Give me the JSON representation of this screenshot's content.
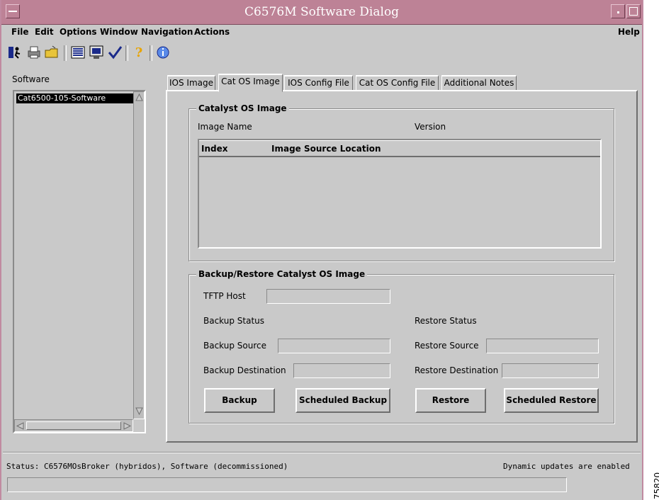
{
  "window": {
    "title": "C6576M Software Dialog"
  },
  "menubar": {
    "items": [
      {
        "name": "menu-file",
        "label": "File"
      },
      {
        "name": "menu-edit",
        "label": "Edit"
      },
      {
        "name": "menu-options",
        "label": "Options"
      },
      {
        "name": "menu-window",
        "label": "Window"
      },
      {
        "name": "menu-navigation",
        "label": "Navigation"
      },
      {
        "name": "menu-actions",
        "label": "Actions"
      }
    ],
    "help": "Help"
  },
  "toolbar": {
    "icons": [
      "exit-icon",
      "print-icon",
      "open-folder-icon",
      "list-icon",
      "monitor-icon",
      "check-icon",
      "help-icon",
      "info-icon"
    ]
  },
  "sidebar": {
    "label": "Software",
    "items": [
      "Cat6500-105-Software"
    ]
  },
  "tabs": [
    {
      "label": "IOS Image",
      "active": false
    },
    {
      "label": "Cat OS Image",
      "active": true
    },
    {
      "label": "IOS Config File",
      "active": false
    },
    {
      "label": "Cat OS Config File",
      "active": false
    },
    {
      "label": "Additional Notes",
      "active": false
    }
  ],
  "catos_group": {
    "title": "Catalyst OS Image",
    "image_name_label": "Image Name",
    "version_label": "Version",
    "table_headers": [
      "Index",
      "Image Source Location"
    ]
  },
  "backup_group": {
    "title": "Backup/Restore Catalyst OS Image",
    "tftp_host_label": "TFTP Host",
    "backup_status_label": "Backup Status",
    "restore_status_label": "Restore Status",
    "backup_source_label": "Backup Source",
    "restore_source_label": "Restore Source",
    "backup_destination_label": "Backup Destination",
    "restore_destination_label": "Restore Destination",
    "buttons": {
      "backup": "Backup",
      "scheduled_backup": "Scheduled Backup",
      "restore": "Restore",
      "scheduled_restore": "Scheduled Restore"
    }
  },
  "statusbar": {
    "status": "Status: C6576MOsBroker (hybridos), Software (decommissioned)",
    "updates": "Dynamic updates are enabled"
  },
  "figure_number": "75820"
}
